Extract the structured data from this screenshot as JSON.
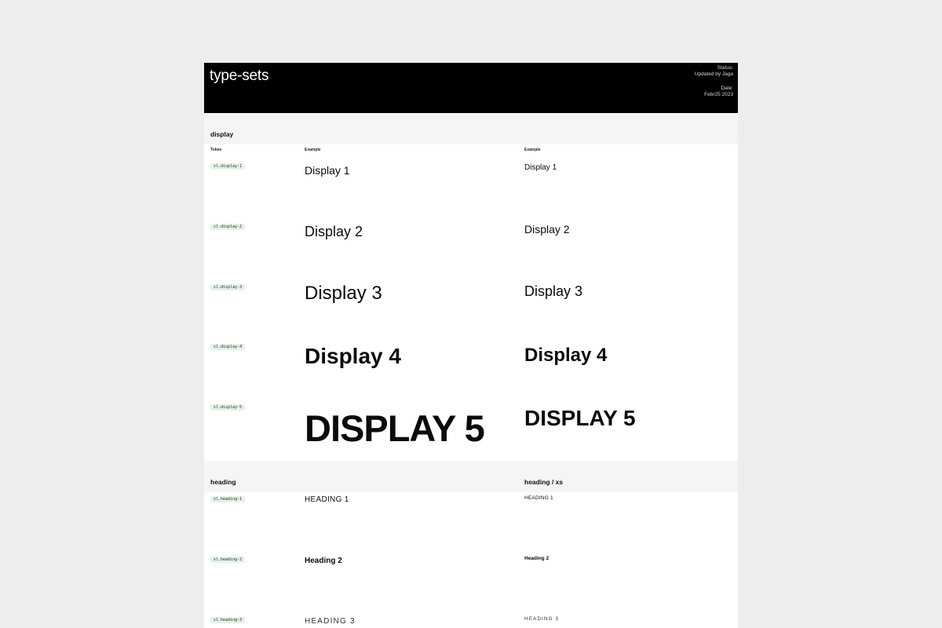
{
  "header": {
    "title": "type-sets",
    "status_label": "Status:",
    "status_value": "Updated by Jaga",
    "date_label": "Date:",
    "date_value": "Febr25 2023"
  },
  "display": {
    "section_label": "display",
    "col_token": "Token",
    "col_example_1": "Example",
    "col_example_2": "Example",
    "rows": [
      {
        "token": "xl.display-1",
        "example": "Display 1",
        "example_small": "Display 1"
      },
      {
        "token": "xl.display-2",
        "example": "Display 2",
        "example_small": "Display 2"
      },
      {
        "token": "xl.display-3",
        "example": "Display 3",
        "example_small": "Display 3"
      },
      {
        "token": "xl.display-4",
        "example": "Display 4",
        "example_small": "Display 4"
      },
      {
        "token": "xl.display-5",
        "example": "DISPLAY 5",
        "example_small": "DISPLAY 5"
      }
    ]
  },
  "heading": {
    "section_label": "heading",
    "section_label_xs": "heading / xs",
    "rows": [
      {
        "token": "xl.heading-1",
        "example": "HEADING 1",
        "example_small": "HEADING 1"
      },
      {
        "token": "xl.heading-2",
        "example": "Heading 2",
        "example_small": "Heading 2"
      },
      {
        "token": "xl.heading-3",
        "example": "HEADING 3",
        "example_small": "HEADING 3"
      }
    ]
  }
}
